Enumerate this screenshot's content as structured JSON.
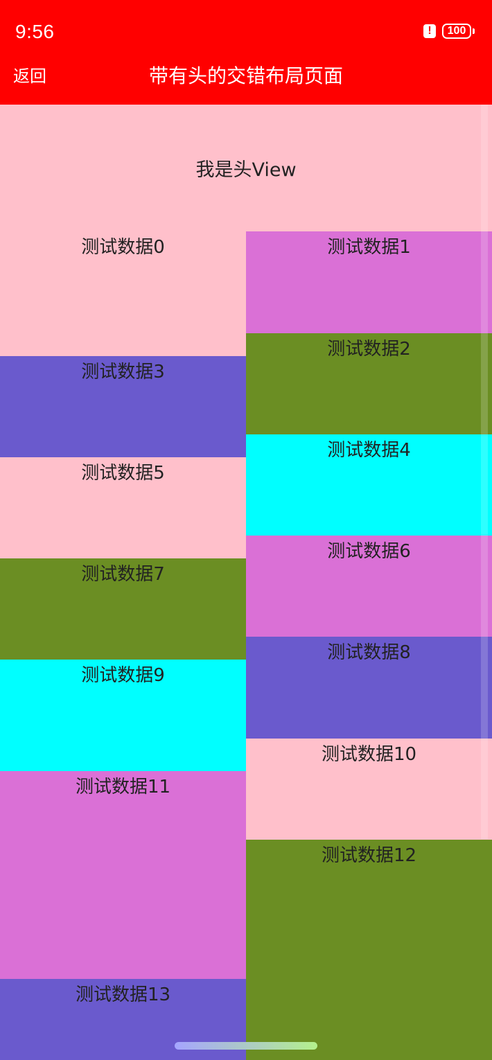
{
  "status_bar": {
    "time": "9:56",
    "alert_glyph": "!",
    "battery_level": "100",
    "background_color": "#ff0000"
  },
  "nav": {
    "back_label": "返回",
    "title": "带有头的交错布局页面"
  },
  "header_view": {
    "label": "我是头View",
    "color": "#ffc0cb"
  },
  "items": [
    {
      "label": "测试数据0",
      "color": "#ffc0cb"
    },
    {
      "label": "测试数据1",
      "color": "#da70d6"
    },
    {
      "label": "测试数据2",
      "color": "#6b8e23"
    },
    {
      "label": "测试数据3",
      "color": "#6a5acd"
    },
    {
      "label": "测试数据4",
      "color": "#00ffff"
    },
    {
      "label": "测试数据5",
      "color": "#ffc0cb"
    },
    {
      "label": "测试数据6",
      "color": "#da70d6"
    },
    {
      "label": "测试数据7",
      "color": "#6b8e23"
    },
    {
      "label": "测试数据8",
      "color": "#6a5acd"
    },
    {
      "label": "测试数据9",
      "color": "#00ffff"
    },
    {
      "label": "测试数据10",
      "color": "#ffc0cb"
    },
    {
      "label": "测试数据11",
      "color": "#da70d6"
    },
    {
      "label": "测试数据12",
      "color": "#6b8e23"
    },
    {
      "label": "测试数据13",
      "color": "#6a5acd"
    }
  ]
}
